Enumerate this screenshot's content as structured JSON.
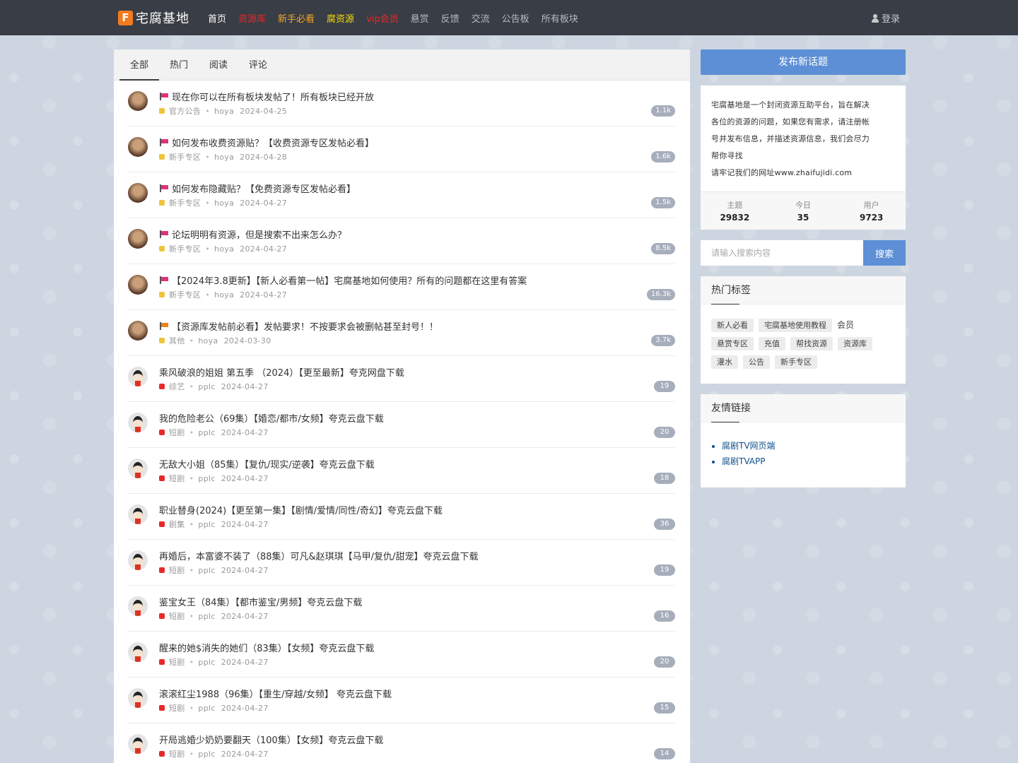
{
  "header": {
    "logo_mark": "F",
    "logo_text": "宅腐基地",
    "nav": [
      {
        "label": "首页",
        "color": "#ffffff"
      },
      {
        "label": "资源库",
        "color": "#e8282a"
      },
      {
        "label": "新手必看",
        "color": "#f5a623"
      },
      {
        "label": "腐资源",
        "color": "#f5d90a"
      },
      {
        "label": "vip会员",
        "color": "#e8282a"
      },
      {
        "label": "悬赏",
        "color": "#b8bbbf"
      },
      {
        "label": "反馈",
        "color": "#b8bbbf"
      },
      {
        "label": "交流",
        "color": "#b8bbbf"
      },
      {
        "label": "公告板",
        "color": "#b8bbbf"
      },
      {
        "label": "所有板块",
        "color": "#b8bbbf"
      }
    ],
    "login_label": "登录"
  },
  "tabs": [
    "全部",
    "热门",
    "阅读",
    "评论"
  ],
  "topics": [
    {
      "flag": "pink",
      "title": "现在你可以在所有板块发帖了！所有板块已经开放",
      "category": "官方公告",
      "cat_color": "#f0c33c",
      "author": "hoya",
      "date": "2024-04-25",
      "count": "1.1k",
      "avatar": "hoya"
    },
    {
      "flag": "pink",
      "title": "如何发布收费资源贴？【收费资源专区发帖必看】",
      "category": "新手专区",
      "cat_color": "#f0c33c",
      "author": "hoya",
      "date": "2024-04-28",
      "count": "1.6k",
      "avatar": "hoya"
    },
    {
      "flag": "pink",
      "title": "如何发布隐藏贴？【免费资源专区发帖必看】",
      "category": "新手专区",
      "cat_color": "#f0c33c",
      "author": "hoya",
      "date": "2024-04-27",
      "count": "1.5k",
      "avatar": "hoya"
    },
    {
      "flag": "pink",
      "title": "论坛明明有资源，但是搜索不出来怎么办？",
      "category": "新手专区",
      "cat_color": "#f0c33c",
      "author": "hoya",
      "date": "2024-04-27",
      "count": "8.5k",
      "avatar": "hoya"
    },
    {
      "flag": "pink",
      "title": "【2024年3.8更新】【新人必看第一帖】宅腐基地如何使用？所有的问题都在这里有答案",
      "category": "新手专区",
      "cat_color": "#f0c33c",
      "author": "hoya",
      "date": "2024-04-27",
      "count": "16.3k",
      "avatar": "hoya"
    },
    {
      "flag": "orange",
      "title": "【资源库发帖前必看】发帖要求！不按要求会被删帖甚至封号！！",
      "category": "其他",
      "cat_color": "#f0c33c",
      "author": "hoya",
      "date": "2024-03-30",
      "count": "3.7k",
      "avatar": "hoya"
    },
    {
      "flag": "",
      "title": "乘风破浪的姐姐 第五季 （2024）【更至最新】夸克网盘下载",
      "category": "综艺",
      "cat_color": "#e8282a",
      "author": "pplc",
      "date": "2024-04-27",
      "count": "19",
      "avatar": "pplc"
    },
    {
      "flag": "",
      "title": "我的危险老公（69集）【婚恋/都市/女频】夸克云盘下载",
      "category": "短剧",
      "cat_color": "#e8282a",
      "author": "pplc",
      "date": "2024-04-27",
      "count": "20",
      "avatar": "pplc"
    },
    {
      "flag": "",
      "title": "无敌大小姐（85集）【复仇/现实/逆袭】夸克云盘下载",
      "category": "短剧",
      "cat_color": "#e8282a",
      "author": "pplc",
      "date": "2024-04-27",
      "count": "18",
      "avatar": "pplc"
    },
    {
      "flag": "",
      "title": "职业替身(2024)【更至第一集】【剧情/爱情/同性/奇幻】夸克云盘下载",
      "category": "剧集",
      "cat_color": "#e8282a",
      "author": "pplc",
      "date": "2024-04-27",
      "count": "36",
      "avatar": "pplc"
    },
    {
      "flag": "",
      "title": "再婚后，本富婆不装了（88集）可凡&赵琪琪【马甲/复仇/甜宠】夸克云盘下载",
      "category": "短剧",
      "cat_color": "#e8282a",
      "author": "pplc",
      "date": "2024-04-27",
      "count": "19",
      "avatar": "pplc"
    },
    {
      "flag": "",
      "title": "鉴宝女王（84集）【都市鉴宝/男频】夸克云盘下载",
      "category": "短剧",
      "cat_color": "#e8282a",
      "author": "pplc",
      "date": "2024-04-27",
      "count": "16",
      "avatar": "pplc"
    },
    {
      "flag": "",
      "title": "醒来的她$消失的她们（83集）【女频】夸克云盘下载",
      "category": "短剧",
      "cat_color": "#e8282a",
      "author": "pplc",
      "date": "2024-04-27",
      "count": "20",
      "avatar": "pplc"
    },
    {
      "flag": "",
      "title": "滚滚红尘1988（96集）【重生/穿越/女频】 夸克云盘下载",
      "category": "短剧",
      "cat_color": "#e8282a",
      "author": "pplc",
      "date": "2024-04-27",
      "count": "15",
      "avatar": "pplc"
    },
    {
      "flag": "",
      "title": "开局逃婚少奶奶要翻天（100集）【女频】夸克云盘下载",
      "category": "短剧",
      "cat_color": "#e8282a",
      "author": "pplc",
      "date": "2024-04-27",
      "count": "14",
      "avatar": "pplc"
    }
  ],
  "sidebar": {
    "post_button": "发布新话题",
    "intro_lines": [
      "宅腐基地是一个封闭资源互助平台，旨在解决",
      "各位的资源的问题，如果您有需求，请注册帐",
      "号并发布信息，并描述资源信息，我们会尽力",
      "帮你寻找",
      "请牢记我们的网址www.zhaifujidi.com"
    ],
    "stats": [
      {
        "label": "主题",
        "value": "29832"
      },
      {
        "label": "今日",
        "value": "35"
      },
      {
        "label": "用户",
        "value": "9723"
      }
    ],
    "search_placeholder": "请输入搜索内容",
    "search_button": "搜索",
    "tags_title": "热门标签",
    "tags": [
      {
        "label": "新人必看",
        "plain": false
      },
      {
        "label": "宅腐基地使用教程",
        "plain": false
      },
      {
        "label": "会员",
        "plain": true
      },
      {
        "label": "悬赏专区",
        "plain": false
      },
      {
        "label": "充值",
        "plain": false
      },
      {
        "label": "帮找资源",
        "plain": false
      },
      {
        "label": "资源库",
        "plain": false
      },
      {
        "label": "灌水",
        "plain": false
      },
      {
        "label": "公告",
        "plain": false
      },
      {
        "label": "新手专区",
        "plain": false
      }
    ],
    "links_title": "友情链接",
    "links": [
      "腐剧TV网页端",
      "腐剧TVAPP"
    ]
  }
}
